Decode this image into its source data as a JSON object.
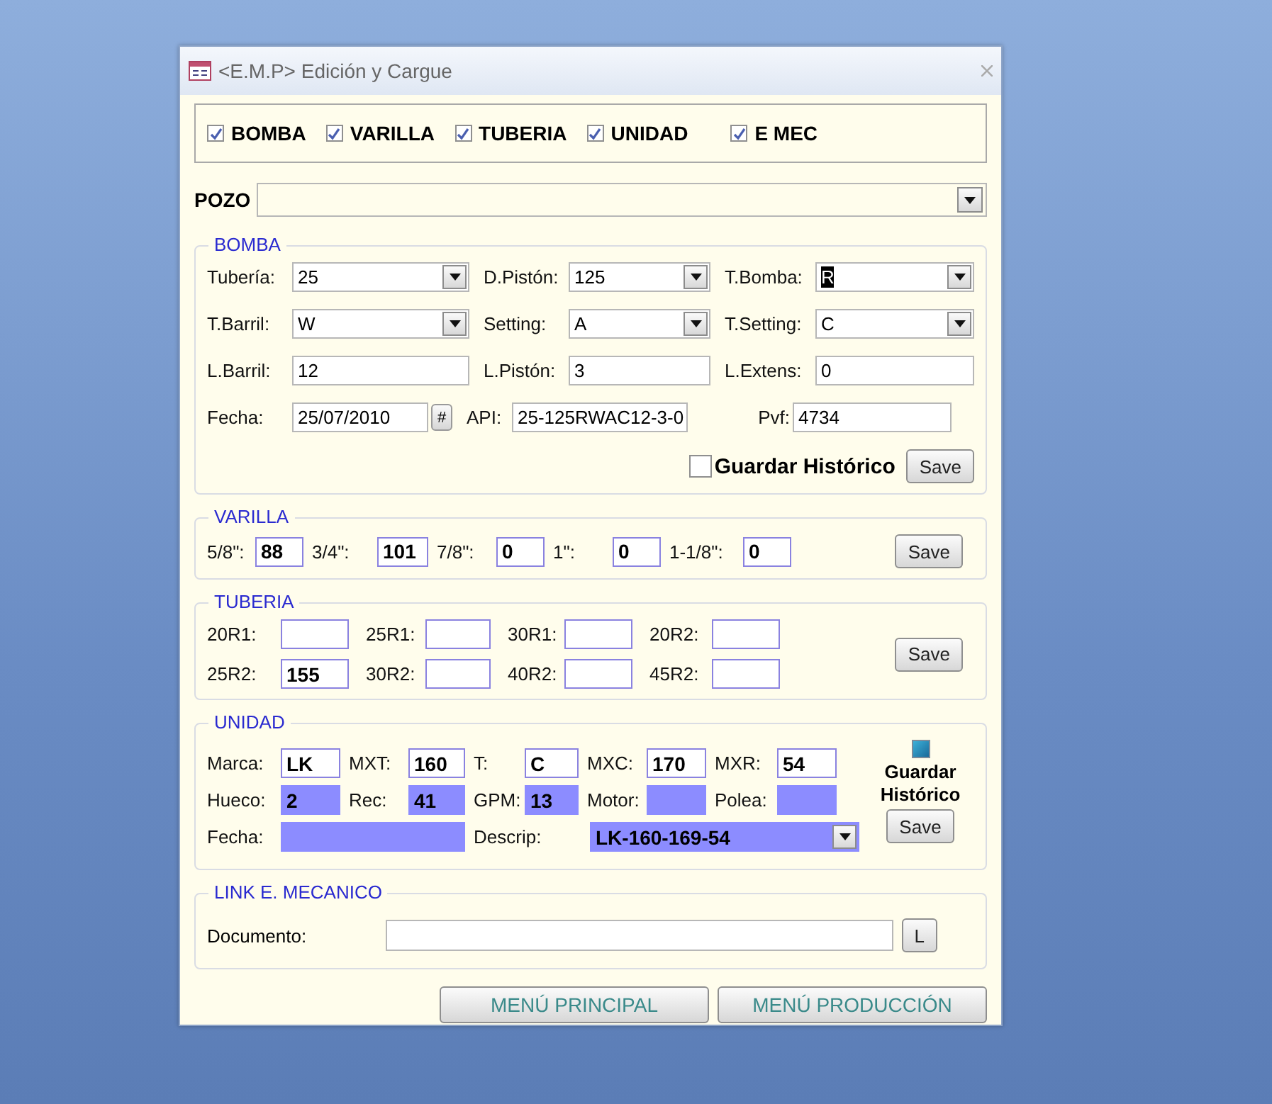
{
  "window": {
    "title": "<E.M.P> Edición y Cargue"
  },
  "toggles": [
    {
      "label": "BOMBA",
      "checked": true
    },
    {
      "label": "VARILLA",
      "checked": true
    },
    {
      "label": "TUBERIA",
      "checked": true
    },
    {
      "label": "UNIDAD",
      "checked": true
    },
    {
      "label": "E MEC",
      "checked": true
    }
  ],
  "pozo": {
    "label": "POZO"
  },
  "bomba": {
    "title": "BOMBA",
    "rows": [
      [
        {
          "label": "Tubería:",
          "value": "25",
          "kind": "combo"
        },
        {
          "label": "D.Pistón:",
          "value": "125",
          "kind": "combo"
        },
        {
          "label": "T.Bomba:",
          "value": "R",
          "kind": "combo",
          "highlighted": true
        }
      ],
      [
        {
          "label": "T.Barril:",
          "value": "W",
          "kind": "combo"
        },
        {
          "label": "Setting:",
          "value": "A",
          "kind": "combo"
        },
        {
          "label": "T.Setting:",
          "value": "C",
          "kind": "combo"
        }
      ],
      [
        {
          "label": "L.Barril:",
          "value": "12",
          "kind": "text"
        },
        {
          "label": "L.Pistón:",
          "value": "3",
          "kind": "text"
        },
        {
          "label": "L.Extens:",
          "value": "0",
          "kind": "text"
        }
      ],
      [
        {
          "label": "Fecha:",
          "value": "25/07/2010",
          "kind": "date",
          "button": "#"
        },
        {
          "label": "API:",
          "value": "25-125RWAC12-3-0",
          "kind": "text"
        },
        {
          "label": "Pvf:",
          "value": "4734",
          "kind": "text"
        }
      ]
    ],
    "historico": {
      "label": "Guardar Histórico",
      "checked": false
    },
    "save": "Save"
  },
  "varilla": {
    "title": "VARILLA",
    "fields": [
      {
        "label": "5/8\":",
        "value": "88"
      },
      {
        "label": "3/4\":",
        "value": "101"
      },
      {
        "label": "7/8\":",
        "value": "0"
      },
      {
        "label": "1\":",
        "value": "0"
      },
      {
        "label": "1-1/8\":",
        "value": "0"
      }
    ],
    "save": "Save"
  },
  "tuberia": {
    "title": "TUBERIA",
    "rows": [
      [
        {
          "label": "20R1:"
        },
        {
          "label": "25R1:"
        },
        {
          "label": "30R1:"
        },
        {
          "label": "20R2:"
        }
      ],
      [
        {
          "label": "25R2:",
          "value": "155"
        },
        {
          "label": "30R2:"
        },
        {
          "label": "40R2:"
        },
        {
          "label": "45R2:"
        }
      ]
    ],
    "save": "Save"
  },
  "unidad": {
    "title": "UNIDAD",
    "rows": [
      [
        {
          "label": "Marca:",
          "value": "LK",
          "kind": "text"
        },
        {
          "label": "MXT:",
          "value": "160",
          "kind": "text"
        },
        {
          "label": "T:",
          "value": "C",
          "kind": "text"
        },
        {
          "label": "MXC:",
          "value": "170",
          "kind": "text"
        },
        {
          "label": "MXR:",
          "value": "54",
          "kind": "text"
        }
      ],
      [
        {
          "label": "Hueco:",
          "value": "2",
          "kind": "shaded"
        },
        {
          "label": "Rec:",
          "value": "41",
          "kind": "shaded"
        },
        {
          "label": "GPM:",
          "value": "13",
          "kind": "shaded"
        },
        {
          "label": "Motor:",
          "kind": "shaded"
        },
        {
          "label": "Polea:",
          "kind": "shaded"
        }
      ],
      [
        {
          "label": "Fecha:",
          "kind": "shaded"
        },
        "",
        {
          "label": "Descrip:",
          "value": "LK-160-169-54",
          "kind": "shaded-combo"
        }
      ]
    ],
    "historico": {
      "label": "Guardar Histórico",
      "checked": true
    },
    "save": "Save"
  },
  "link": {
    "title": "LINK E. MECANICO",
    "label": "Documento:",
    "button": "L"
  },
  "buttons": [
    "MENÚ PRINCIPAL",
    "MENÚ PRODUCCIÓN"
  ]
}
